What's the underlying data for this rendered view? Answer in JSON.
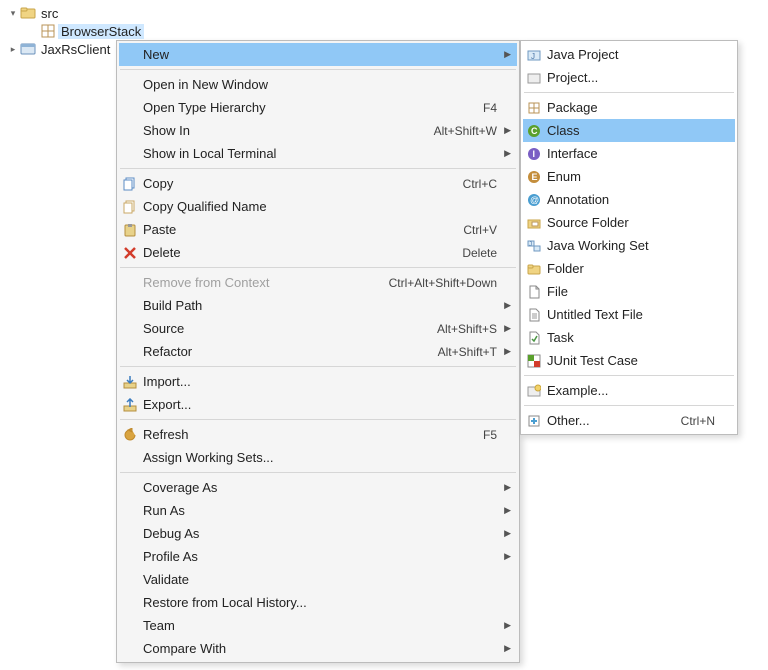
{
  "tree": {
    "src": "src",
    "browserstack": "BrowserStack",
    "jaxrsclient": "JaxRsClient"
  },
  "ctx_main": [
    {
      "type": "item",
      "icon": "",
      "label": "New",
      "hint": "",
      "arrow": true,
      "hl": true,
      "name": "menu-new"
    },
    {
      "type": "sep"
    },
    {
      "type": "item",
      "icon": "",
      "label": "Open in New Window",
      "hint": "",
      "name": "menu-open-new-window"
    },
    {
      "type": "item",
      "icon": "",
      "label": "Open Type Hierarchy",
      "hint": "F4",
      "name": "menu-open-type-hierarchy"
    },
    {
      "type": "item",
      "icon": "",
      "label": "Show In",
      "hint": "Alt+Shift+W",
      "arrow": true,
      "name": "menu-show-in"
    },
    {
      "type": "item",
      "icon": "",
      "label": "Show in Local Terminal",
      "hint": "",
      "arrow": true,
      "name": "menu-show-local-terminal"
    },
    {
      "type": "sep"
    },
    {
      "type": "item",
      "icon": "copy",
      "label": "Copy",
      "hint": "Ctrl+C",
      "name": "menu-copy"
    },
    {
      "type": "item",
      "icon": "copyq",
      "label": "Copy Qualified Name",
      "hint": "",
      "name": "menu-copy-qualified"
    },
    {
      "type": "item",
      "icon": "paste",
      "label": "Paste",
      "hint": "Ctrl+V",
      "name": "menu-paste"
    },
    {
      "type": "item",
      "icon": "delete",
      "label": "Delete",
      "hint": "Delete",
      "name": "menu-delete"
    },
    {
      "type": "sep"
    },
    {
      "type": "item",
      "icon": "",
      "label": "Remove from Context",
      "hint": "Ctrl+Alt+Shift+Down",
      "disabled": true,
      "name": "menu-remove-context"
    },
    {
      "type": "item",
      "icon": "",
      "label": "Build Path",
      "hint": "",
      "arrow": true,
      "name": "menu-build-path"
    },
    {
      "type": "item",
      "icon": "",
      "label": "Source",
      "hint": "Alt+Shift+S",
      "arrow": true,
      "name": "menu-source"
    },
    {
      "type": "item",
      "icon": "",
      "label": "Refactor",
      "hint": "Alt+Shift+T",
      "arrow": true,
      "name": "menu-refactor"
    },
    {
      "type": "sep"
    },
    {
      "type": "item",
      "icon": "import",
      "label": "Import...",
      "hint": "",
      "name": "menu-import"
    },
    {
      "type": "item",
      "icon": "export",
      "label": "Export...",
      "hint": "",
      "name": "menu-export"
    },
    {
      "type": "sep"
    },
    {
      "type": "item",
      "icon": "refresh",
      "label": "Refresh",
      "hint": "F5",
      "name": "menu-refresh"
    },
    {
      "type": "item",
      "icon": "",
      "label": "Assign Working Sets...",
      "hint": "",
      "name": "menu-assign-ws"
    },
    {
      "type": "sep"
    },
    {
      "type": "item",
      "icon": "",
      "label": "Coverage As",
      "hint": "",
      "arrow": true,
      "name": "menu-coverage-as"
    },
    {
      "type": "item",
      "icon": "",
      "label": "Run As",
      "hint": "",
      "arrow": true,
      "name": "menu-run-as"
    },
    {
      "type": "item",
      "icon": "",
      "label": "Debug As",
      "hint": "",
      "arrow": true,
      "name": "menu-debug-as"
    },
    {
      "type": "item",
      "icon": "",
      "label": "Profile As",
      "hint": "",
      "arrow": true,
      "name": "menu-profile-as"
    },
    {
      "type": "item",
      "icon": "",
      "label": "Validate",
      "hint": "",
      "name": "menu-validate"
    },
    {
      "type": "item",
      "icon": "",
      "label": "Restore from Local History...",
      "hint": "",
      "name": "menu-restore-history"
    },
    {
      "type": "item",
      "icon": "",
      "label": "Team",
      "hint": "",
      "arrow": true,
      "name": "menu-team"
    },
    {
      "type": "item",
      "icon": "",
      "label": "Compare With",
      "hint": "",
      "arrow": true,
      "name": "menu-compare-with"
    }
  ],
  "ctx_sub": [
    {
      "type": "item",
      "icon": "jproj",
      "label": "Java Project",
      "name": "sub-java-project"
    },
    {
      "type": "item",
      "icon": "proj",
      "label": "Project...",
      "name": "sub-project"
    },
    {
      "type": "sep"
    },
    {
      "type": "item",
      "icon": "package",
      "label": "Package",
      "name": "sub-package"
    },
    {
      "type": "item",
      "icon": "class",
      "label": "Class",
      "hl": true,
      "name": "sub-class"
    },
    {
      "type": "item",
      "icon": "interface",
      "label": "Interface",
      "name": "sub-interface"
    },
    {
      "type": "item",
      "icon": "enum",
      "label": "Enum",
      "name": "sub-enum"
    },
    {
      "type": "item",
      "icon": "annotation",
      "label": "Annotation",
      "name": "sub-annotation"
    },
    {
      "type": "item",
      "icon": "srcfolder",
      "label": "Source Folder",
      "name": "sub-source-folder"
    },
    {
      "type": "item",
      "icon": "jws",
      "label": "Java Working Set",
      "name": "sub-java-ws"
    },
    {
      "type": "item",
      "icon": "folder",
      "label": "Folder",
      "name": "sub-folder"
    },
    {
      "type": "item",
      "icon": "file",
      "label": "File",
      "name": "sub-file"
    },
    {
      "type": "item",
      "icon": "txt",
      "label": "Untitled Text File",
      "name": "sub-untitled-text"
    },
    {
      "type": "item",
      "icon": "task",
      "label": "Task",
      "name": "sub-task"
    },
    {
      "type": "item",
      "icon": "junit",
      "label": "JUnit Test Case",
      "name": "sub-junit"
    },
    {
      "type": "sep"
    },
    {
      "type": "item",
      "icon": "example",
      "label": "Example...",
      "name": "sub-example"
    },
    {
      "type": "sep"
    },
    {
      "type": "item",
      "icon": "other",
      "label": "Other...",
      "hint": "Ctrl+N",
      "name": "sub-other"
    }
  ]
}
